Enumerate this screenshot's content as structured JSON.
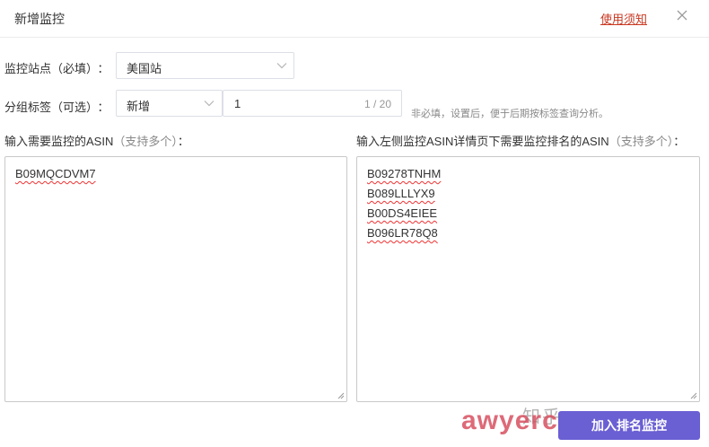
{
  "dialog": {
    "title": "新增监控",
    "help_link": "使用须知"
  },
  "site": {
    "label": "监控站点（必填）",
    "colon": "：",
    "value": "美国站"
  },
  "group": {
    "label": "分组标签（可选）",
    "colon": "：",
    "select_value": "新增",
    "input_value": "1",
    "counter": "1 / 20",
    "hint": "非必填，设置后，便于后期按标签查询分析。"
  },
  "monitor_asins": {
    "label": "输入需要监控的ASIN",
    "label_note": "（支持多个）",
    "colon": "：",
    "values": [
      "B09MQCDVM7"
    ]
  },
  "rank_asins": {
    "label": "输入左侧监控ASIN详情页下需要监控排名的ASIN",
    "label_note": "（支持多个）",
    "colon": "：",
    "values": [
      "B09278TNHM",
      "B089LLLYX9",
      "B00DS4EIEE",
      "B096LR78Q8"
    ]
  },
  "footer": {
    "submit_label": "加入排名监控",
    "watermark": "awyerc",
    "watermark_zh": "知乎"
  },
  "colors": {
    "accent": "#6a5fd3",
    "link": "#c8361f",
    "watermark": "#d6495a"
  }
}
